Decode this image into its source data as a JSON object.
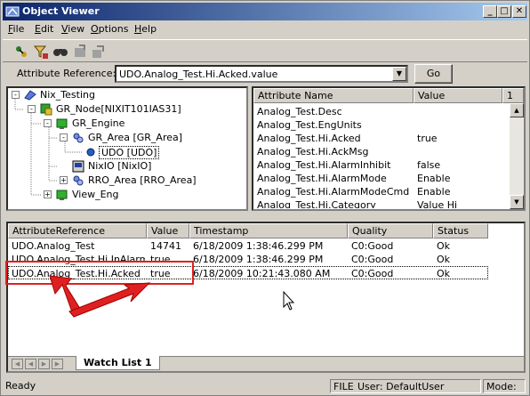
{
  "window": {
    "title": "Object Viewer",
    "minimize": "_",
    "maximize": "□",
    "close": "✕"
  },
  "menu": [
    {
      "key": "F",
      "rest": "ile"
    },
    {
      "key": "E",
      "rest": "dit"
    },
    {
      "key": "V",
      "rest": "iew"
    },
    {
      "key": "O",
      "rest": "ptions"
    },
    {
      "key": "H",
      "rest": "elp"
    }
  ],
  "toolbar": {
    "icons": [
      "connect-icon",
      "filter-icon",
      "find-icon",
      "back-icon",
      "forward-icon"
    ]
  },
  "attribute_bar": {
    "label": "Attribute Reference:",
    "value": "UDO.Analog_Test.Hi.Acked.value",
    "go_label": "Go"
  },
  "tree": [
    {
      "label": "Nix_Testing",
      "expander": "-"
    },
    {
      "label": "GR_Node[NIXIT101IAS31]",
      "expander": "-"
    },
    {
      "label": "GR_Engine",
      "expander": "-"
    },
    {
      "label": "GR_Area [GR_Area]",
      "expander": "-"
    },
    {
      "label": "UDO [UDO]",
      "expander": ""
    },
    {
      "label": "NixIO [NixIO]",
      "expander": ""
    },
    {
      "label": "RRO_Area [RRO_Area]",
      "expander": "+"
    },
    {
      "label": "View_Eng",
      "expander": "+"
    }
  ],
  "attr_grid": {
    "headers": [
      "Attribute Name",
      "Value",
      "1"
    ],
    "rows": [
      {
        "name": "Analog_Test.Desc",
        "value": ""
      },
      {
        "name": "Analog_Test.EngUnits",
        "value": ""
      },
      {
        "name": "Analog_Test.Hi.Acked",
        "value": "true"
      },
      {
        "name": "Analog_Test.Hi.AckMsg",
        "value": ""
      },
      {
        "name": "Analog_Test.Hi.AlarmInhibit",
        "value": "false"
      },
      {
        "name": "Analog_Test.Hi.AlarmMode",
        "value": "Enable"
      },
      {
        "name": "Analog_Test.Hi.AlarmModeCmd",
        "value": "Enable"
      },
      {
        "name": "Analog_Test.Hi.Category",
        "value": "Value Hi"
      }
    ]
  },
  "watch": {
    "headers": [
      "AttributeReference",
      "Value",
      "Timestamp",
      "Quality",
      "Status"
    ],
    "rows": [
      {
        "ref": "UDO.Analog_Test",
        "value": "14741",
        "timestamp": "6/18/2009 1:38:46.299 PM",
        "quality": "C0:Good",
        "status": "Ok"
      },
      {
        "ref": "UDO.Analog_Test.Hi.InAlarm",
        "value": "true",
        "timestamp": "6/18/2009 1:38:46.299 PM",
        "quality": "C0:Good",
        "status": "Ok"
      },
      {
        "ref": "UDO.Analog_Test.Hi.Acked",
        "value": "true",
        "timestamp": "6/18/2009 10:21:43.080 AM",
        "quality": "C0:Good",
        "status": "Ok"
      }
    ],
    "tab_label": "Watch List 1"
  },
  "status": {
    "ready": "Ready",
    "file": "FILE:",
    "user": "User: DefaultUser",
    "mode": "Mode:"
  },
  "annotation_color": "#e02020"
}
